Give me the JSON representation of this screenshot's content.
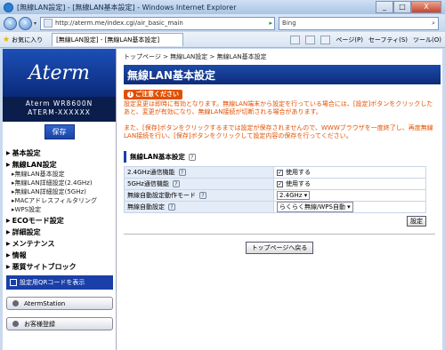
{
  "window": {
    "title": "[無線LAN設定] - [無線LAN基本設定] - Windows Internet Explorer",
    "min": "_",
    "max": "□",
    "close": "X"
  },
  "address": {
    "url": "http://aterm.me/index.cgi/air_basic_main",
    "search": "Bing"
  },
  "favorites": {
    "label": "お気に入り",
    "tab": "[無線LAN設定] - [無線LAN基本設定]",
    "tools": [
      "ページ(P)",
      "セーフティ(S)",
      "ツール(O)"
    ]
  },
  "sidebar": {
    "logo": "Aterm",
    "model_line1": "Aterm WR8600N",
    "model_line2": "ATERM-XXXXXX",
    "save": "保存",
    "menu": [
      {
        "head": "基本設定"
      },
      {
        "head": "無線LAN設定",
        "items": [
          "無線LAN基本設定",
          "無線LAN詳細設定(2.4GHz)",
          "無線LAN詳細設定(5GHz)",
          "MACアドレスフィルタリング",
          "WPS設定"
        ]
      },
      {
        "head": "ECOモード設定"
      },
      {
        "head": "詳細設定"
      },
      {
        "head": "メンテナンス"
      },
      {
        "head": "情報"
      },
      {
        "head": "悪質サイトブロック"
      }
    ],
    "qr": "設定用QRコードを表示",
    "station": "AtermStation",
    "register": "お客様登録"
  },
  "main": {
    "breadcrumb": "トップページ > 無線LAN設定 > 無線LAN基本設定",
    "title": "無線LAN基本設定",
    "notice_badge": "ご注意ください",
    "notice1": "設定変更は即時に有効となります。無線LAN端末から設定を行っている場合には、[設定]ボタンをクリックしたあと、変更が有効になり、無線LAN接続が切断される場合があります。",
    "notice2": "また、[保存]ボタンをクリックするまでは設定が保存されませんので、WWWブラウザを一度終了し、再度無線LAN接続を行い、[保存]ボタンをクリックして設定内容の保存を行ってください。",
    "section": "無線LAN基本設定",
    "rows": [
      {
        "label": "2.4GHz通信機能",
        "value": "使用する"
      },
      {
        "label": "5GHz通信機能",
        "value": "使用する"
      },
      {
        "label": "無線自動設定動作モード",
        "value": "2.4GHz"
      },
      {
        "label": "無線自動設定",
        "value": "らくらく無線/WPS自動"
      }
    ],
    "apply": "設定",
    "back": "トップページへ戻る"
  }
}
